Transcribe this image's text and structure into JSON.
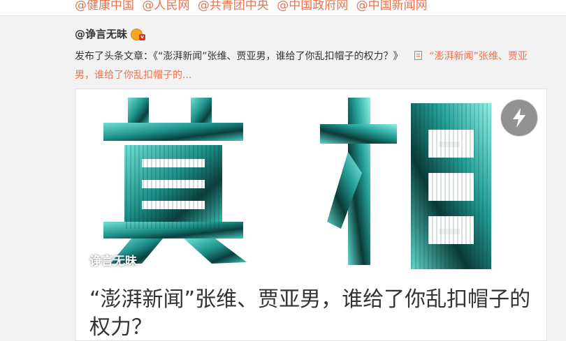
{
  "mentions": [
    "@健康中国",
    "@人民网",
    "@共青团中央",
    "@中国政府网",
    "@中国新闻网"
  ],
  "post": {
    "author": "@诤言无昧",
    "author_badge": "user-badge-icon",
    "description_prefix": "发布了头条文章：《“澎湃新闻”张维、贾亚男，谁给了你乱扣帽子的权力？》",
    "link_text": "“澎湃新闻”张维、贾亚男，谁给了你乱扣帽子的...",
    "link_icon": "document-icon"
  },
  "article": {
    "cover_text": "真相",
    "watermark": "诤言无昧",
    "title": "“澎湃新闻”张维、贾亚男，谁给了你乱扣帽子的权力？",
    "flash_icon": "lightning-icon"
  },
  "colors": {
    "link": "#eb7350",
    "cover_teal": "#3fc4b8",
    "text": "#333333"
  }
}
